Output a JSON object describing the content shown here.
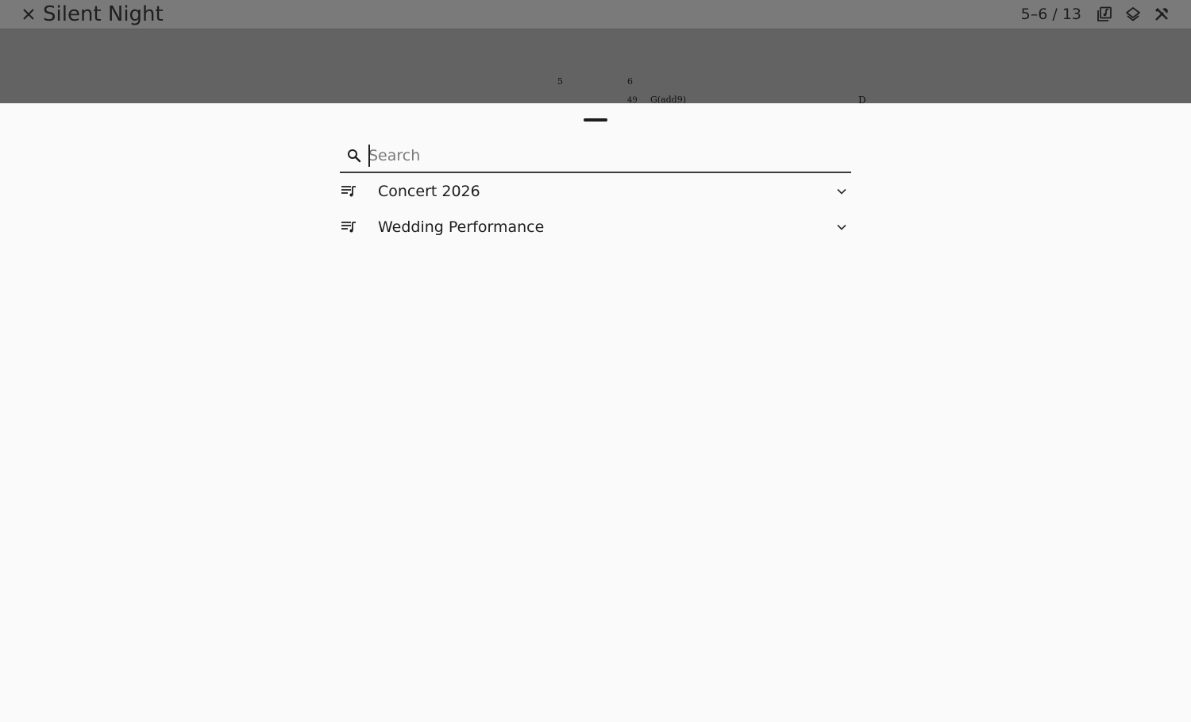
{
  "app_bar": {
    "title": "Silent Night",
    "page_indicator": "5–6 / 13",
    "icons": {
      "close": "close-icon",
      "library": "library-music-icon",
      "layers": "layers-icon",
      "tools": "tools-icon"
    }
  },
  "background_score": {
    "measure_numbers": [
      "5",
      "6"
    ],
    "bar_number": "49",
    "chords": [
      "G(add9)",
      "D"
    ]
  },
  "sheet": {
    "search": {
      "placeholder": "Search",
      "value": ""
    },
    "setlists": [
      {
        "label": "Concert 2026",
        "icon": "playlist-music-icon",
        "expanded": false
      },
      {
        "label": "Wedding Performance",
        "icon": "playlist-music-icon",
        "expanded": false
      }
    ]
  },
  "colors": {
    "topbar": "#7a7a7a",
    "backdrop": "#636363",
    "sheet": "#fafafa",
    "text": "#1e1e1e"
  }
}
